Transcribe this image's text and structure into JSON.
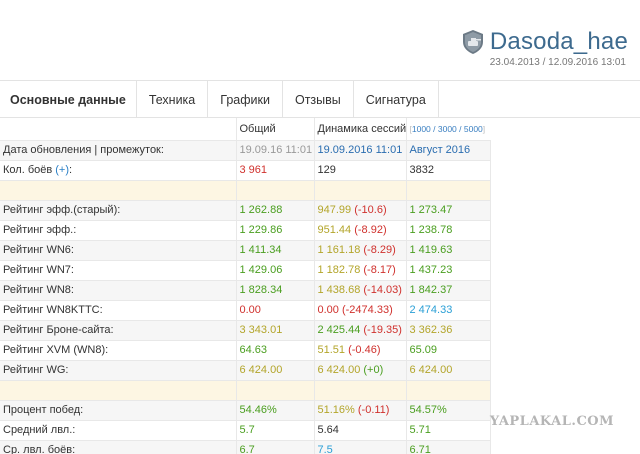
{
  "header": {
    "player_name": "Dasoda_hae",
    "dates": "23.04.2013 / 12.09.2016 13:01",
    "clan_icon": "tank-emblem-icon"
  },
  "tabs": [
    {
      "label": "Основные данные",
      "active": true
    },
    {
      "label": "Техника"
    },
    {
      "label": "Графики"
    },
    {
      "label": "Отзывы"
    },
    {
      "label": "Сигнатура"
    }
  ],
  "columns": {
    "total": "Общий",
    "session": "Динамика сессий",
    "range_open": "[",
    "range_values": "1000 / 3000 / 5000",
    "range_close": "]"
  },
  "rows": {
    "update": {
      "label": "Дата обновления | промежуток:",
      "total": "19.09.16 11:01",
      "session": "19.09.2016 11:01",
      "month": "Август 2016"
    },
    "battles": {
      "label": "Кол. боёв",
      "plus": "(+)",
      "colon": ":",
      "total": "3 961",
      "session": "129",
      "month": "3832"
    },
    "stats": [
      {
        "label": "Рейтинг эфф.(старый):",
        "total": "1 262.88",
        "session": "947.99",
        "delta": "(-10.6)",
        "month": "1 273.47"
      },
      {
        "label": "Рейтинг эфф.:",
        "total": "1 229.86",
        "session": "951.44",
        "delta": "(-8.92)",
        "month": "1 238.78"
      },
      {
        "label": "Рейтинг WN6:",
        "total": "1 411.34",
        "session": "1 161.18",
        "delta": "(-8.29)",
        "month": "1 419.63"
      },
      {
        "label": "Рейтинг WN7:",
        "total": "1 429.06",
        "session": "1 182.78",
        "delta": "(-8.17)",
        "month": "1 437.23"
      },
      {
        "label": "Рейтинг WN8:",
        "total": "1 828.34",
        "session": "1 438.68",
        "delta": "(-14.03)",
        "month": "1 842.37"
      },
      {
        "label": "Рейтинг WN8KTTC:",
        "total": "0.00",
        "session": "0.00",
        "delta": "(-2474.33)",
        "month": "2 474.33"
      },
      {
        "label": "Рейтинг Броне-сайта:",
        "total": "3 343.01",
        "session": "2 425.44",
        "delta": "(-19.35)",
        "month": "3 362.36"
      },
      {
        "label": "Рейтинг XVM (WN8):",
        "total": "64.63",
        "session": "51.51",
        "delta": "(-0.46)",
        "month": "65.09"
      },
      {
        "label": "Рейтинг WG:",
        "total": "6 424.00",
        "session": "6 424.00",
        "delta": "(+0)",
        "month": "6 424.00"
      }
    ],
    "extra": [
      {
        "label": "Процент побед:",
        "total": "54.46%",
        "session": "51.16%",
        "delta": "(-0.11)",
        "month": "54.57%"
      },
      {
        "label": "Средний лвл.:",
        "total": "5.7",
        "session": "5.64",
        "delta": "",
        "month": "5.71"
      },
      {
        "label": "Ср. лвл. боёв:",
        "total": "6.7",
        "session": "7.5",
        "delta": "",
        "month": "6.71"
      }
    ]
  },
  "colors": {
    "green": "#4a9e1f",
    "yellow_green": "#a2a522",
    "red": "#d0312d",
    "blue": "#2a9fd6",
    "olive": "#b3a52a",
    "gray": "#888888",
    "dark": "#333333"
  },
  "watermark": "YAPLAKAL.COM"
}
